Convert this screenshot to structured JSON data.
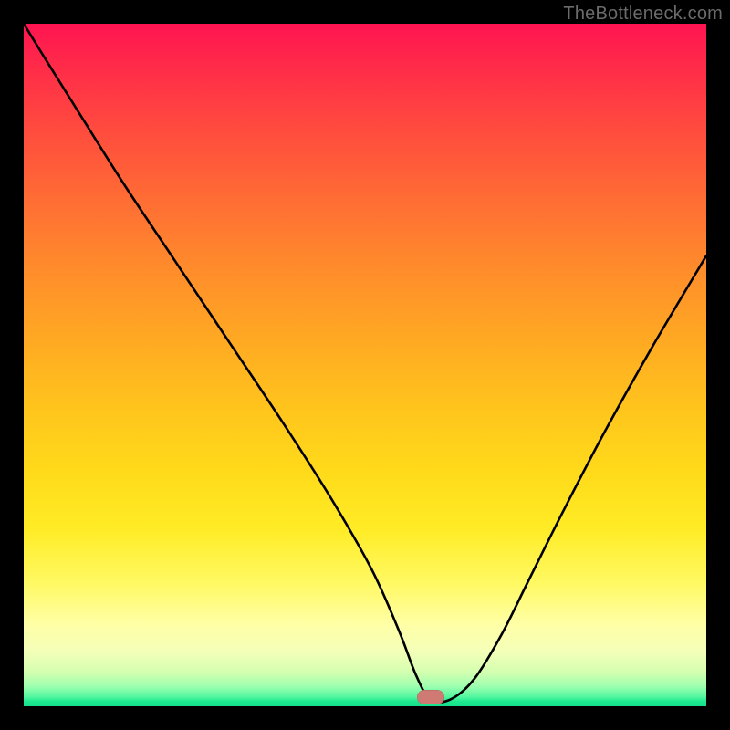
{
  "watermark": "TheBottleneck.com",
  "marker": {
    "x_frac": 0.596,
    "y_frac": 0.986
  },
  "chart_data": {
    "type": "line",
    "title": "",
    "xlabel": "",
    "ylabel": "",
    "xlim": [
      0,
      1
    ],
    "ylim": [
      0,
      1
    ],
    "series": [
      {
        "name": "bottleneck-curve",
        "x": [
          0.0,
          0.04,
          0.09,
          0.15,
          0.22,
          0.3,
          0.38,
          0.45,
          0.51,
          0.55,
          0.575,
          0.596,
          0.625,
          0.66,
          0.7,
          0.74,
          0.79,
          0.85,
          0.92,
          1.0
        ],
        "y": [
          1.0,
          0.935,
          0.855,
          0.76,
          0.655,
          0.535,
          0.415,
          0.305,
          0.2,
          0.11,
          0.045,
          0.01,
          0.01,
          0.04,
          0.105,
          0.185,
          0.285,
          0.4,
          0.525,
          0.66
        ]
      }
    ],
    "marker_position": {
      "x": 0.596,
      "y": 0.01
    },
    "gradient_stops": [
      {
        "pos": 0.0,
        "color": "#ff1451"
      },
      {
        "pos": 0.25,
        "color": "#ff6a35"
      },
      {
        "pos": 0.57,
        "color": "#ffc61c"
      },
      {
        "pos": 0.82,
        "color": "#fff963"
      },
      {
        "pos": 0.95,
        "color": "#d4ffb0"
      },
      {
        "pos": 1.0,
        "color": "#18df8c"
      }
    ]
  }
}
